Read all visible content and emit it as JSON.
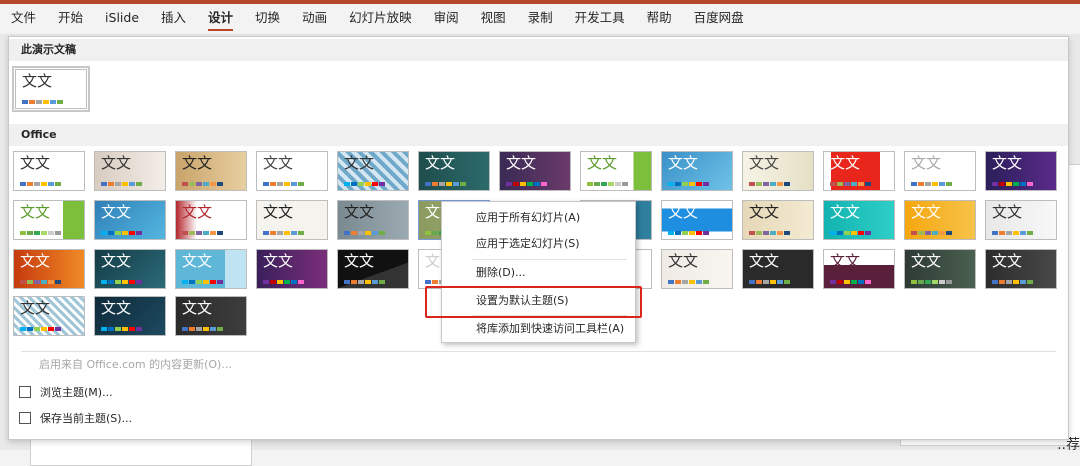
{
  "ribbon": {
    "tabs": [
      "文件",
      "开始",
      "iSlide",
      "插入",
      "设计",
      "切换",
      "动画",
      "幻灯片放映",
      "审阅",
      "视图",
      "录制",
      "开发工具",
      "帮助",
      "百度网盘"
    ],
    "active_tab": "设计"
  },
  "gallery": {
    "this_presentation_label": "此演示文稿",
    "office_label": "Office",
    "theme_title_text": "文文",
    "palettes": {
      "office": [
        "#4472c4",
        "#ed7d31",
        "#a5a5a5",
        "#ffc000",
        "#5b9bd5",
        "#70ad47"
      ],
      "warm": [
        "#c0504d",
        "#9bbb59",
        "#8064a2",
        "#4bacc6",
        "#f79646",
        "#1f497d"
      ],
      "green": [
        "#8fc13e",
        "#6aa84f",
        "#34a853",
        "#a6d96a",
        "#cccccc",
        "#999999"
      ],
      "blue": [
        "#00b0f0",
        "#0070c0",
        "#92d050",
        "#ffc000",
        "#ff0000",
        "#7030a0"
      ],
      "purple": [
        "#7030a0",
        "#c00000",
        "#ffc000",
        "#00b050",
        "#0070c0",
        "#ff66cc"
      ]
    }
  },
  "footer": {
    "update_label": "启用来自 Office.com 的内容更新(O)...",
    "browse_label": "浏览主题(M)...",
    "save_label": "保存当前主题(S)..."
  },
  "context_menu": {
    "items": [
      "应用于所有幻灯片(A)",
      "应用于选定幻灯片(S)",
      "删除(D)...",
      "设置为默认主题(S)",
      "将库添加到快速访问工具栏(A)"
    ],
    "highlighted_index": 3
  },
  "background": {
    "right_edge_text": "..荐"
  }
}
